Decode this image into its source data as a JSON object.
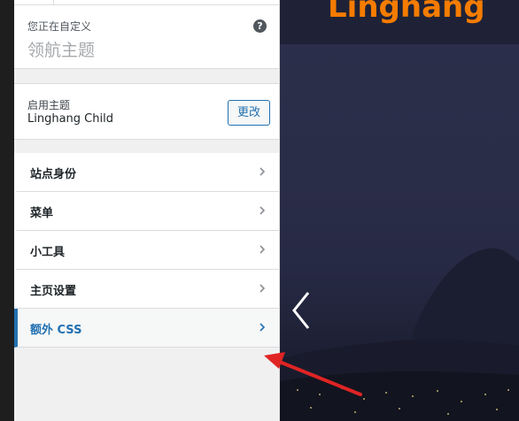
{
  "customizer": {
    "info_small": "您正在自定义",
    "info_title": "领航主题",
    "help_glyph": "?",
    "active_theme_label": "启用主题",
    "active_theme_name": "Linghang Child",
    "change_button": "更改",
    "sections": [
      {
        "label": "站点身份"
      },
      {
        "label": "菜单"
      },
      {
        "label": "小工具"
      },
      {
        "label": "主页设置"
      },
      {
        "label": "额外 CSS",
        "active": true
      }
    ]
  },
  "preview": {
    "logo_text": "Linghang",
    "logo_color": "#f57c00"
  },
  "colors": {
    "accent": "#2271b1",
    "arrow": "#e02424"
  }
}
